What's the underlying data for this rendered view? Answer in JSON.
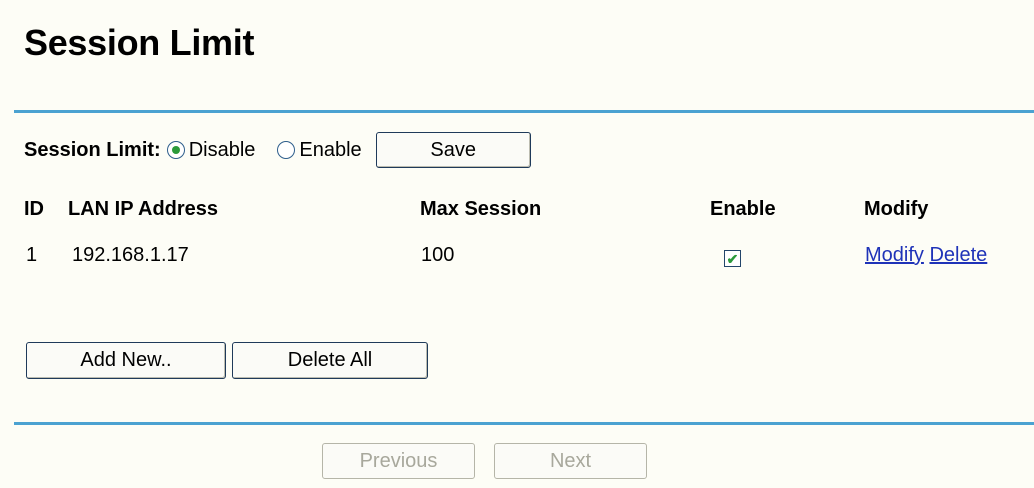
{
  "page": {
    "title": "Session Limit"
  },
  "session_limit": {
    "label": "Session Limit:",
    "options": [
      "Disable",
      "Enable"
    ],
    "selected": "Disable",
    "save_label": "Save"
  },
  "table": {
    "headers": [
      "ID",
      "LAN IP Address",
      "Max Session",
      "Enable",
      "Modify"
    ],
    "rows": [
      {
        "id": "1",
        "lan_ip": "192.168.1.17",
        "max_session": "100",
        "enabled": true,
        "modify_link": "Modify",
        "delete_link": "Delete"
      }
    ]
  },
  "actions": {
    "add_new_label": "Add New..",
    "delete_all_label": "Delete All"
  },
  "pagination": {
    "previous_label": "Previous",
    "next_label": "Next",
    "previous_enabled": false,
    "next_enabled": false
  },
  "colors": {
    "background": "#fdfdf6",
    "divider": "#4ba2d1",
    "link": "#1f33b8",
    "check": "#2b9a3a"
  },
  "icons": {
    "radio_selected": "radio-selected-icon",
    "radio_unselected": "radio-unselected-icon",
    "checkbox_checked": "checkmark-icon"
  }
}
